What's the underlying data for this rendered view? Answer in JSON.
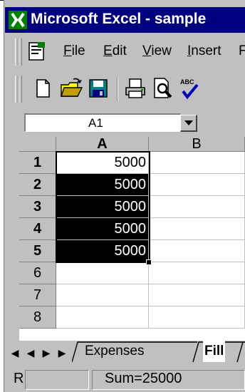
{
  "app": {
    "title": "Microsoft Excel - sample",
    "colors": {
      "titlebar": "#000080",
      "chrome": "#c0c0c0",
      "selection": "#000000"
    }
  },
  "menu": {
    "items": [
      {
        "label": "File",
        "accel": "F"
      },
      {
        "label": "Edit",
        "accel": "E"
      },
      {
        "label": "View",
        "accel": "V"
      },
      {
        "label": "Insert",
        "accel": "I"
      }
    ]
  },
  "toolbar": {
    "buttons": [
      "new-icon",
      "open-icon",
      "save-icon",
      "print-icon",
      "print-preview-icon",
      "spelling-icon"
    ]
  },
  "formula_bar": {
    "name_box": "A1"
  },
  "sheet": {
    "columns": [
      "A",
      "B"
    ],
    "rows": [
      "1",
      "2",
      "3",
      "4",
      "5",
      "6",
      "7",
      "8"
    ],
    "values": [
      "5000",
      "5000",
      "5000",
      "5000",
      "5000"
    ]
  },
  "tabs": {
    "nav": [
      "first-sheet-icon",
      "prev-sheet-icon",
      "next-sheet-icon",
      "last-sheet-icon"
    ],
    "sheets": [
      "Expenses",
      "Fill"
    ],
    "active": "Fill"
  },
  "status": {
    "left": "R",
    "sum": "Sum=25000"
  }
}
